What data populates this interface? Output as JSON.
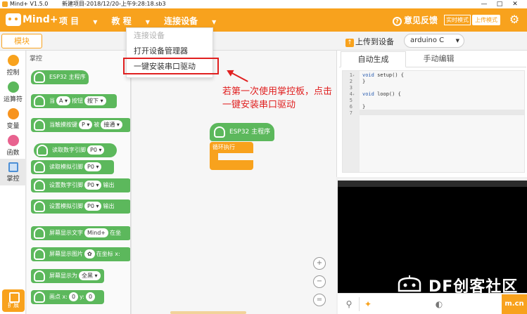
{
  "titlebar": {
    "app": "Mind+ V1.5.0",
    "file": "新建项目-2018/12/20-上午9:28:18.sb3",
    "min": "—",
    "max": "□",
    "close": "✕"
  },
  "header": {
    "brand": "Mind+",
    "menu": [
      {
        "label": "项 目"
      },
      {
        "label": "教 程"
      },
      {
        "label": "连接设备"
      }
    ],
    "caret": "▼",
    "feedback": "意见反馈",
    "feedback_icon": "?",
    "mode_realtime": "实时模式",
    "mode_upload": "上传模式",
    "gear": "⚙"
  },
  "toolbar": {
    "blocks_tab": "模块",
    "upload": "上传到设备",
    "upload_icon": "↑",
    "board": "arduino C",
    "board_caret": "▼"
  },
  "dropdown": {
    "items": [
      {
        "label": "连接设备",
        "disabled": true
      },
      {
        "label": "打开设备管理器"
      },
      {
        "label": "一键安装串口驱动"
      }
    ]
  },
  "categories": [
    {
      "label": "控制",
      "color": "#f8a21d"
    },
    {
      "label": "运算符",
      "color": "#5cb85c"
    },
    {
      "label": "变量",
      "color": "#f7931e"
    },
    {
      "label": "函数",
      "color": "#e8628f"
    },
    {
      "label": "掌控",
      "color": "#4c8fd6"
    }
  ],
  "extension": "扩展",
  "palette": {
    "title": "掌控",
    "blocks": [
      {
        "text": "ESP32 主程序"
      },
      {
        "text": "当",
        "s1": "A ▾",
        "t2": "按钮",
        "s2": "按下 ▾"
      },
      {
        "text": "当触摸按键",
        "s1": "P ▾",
        "t2": "被",
        "s2": "接通 ▾"
      },
      {
        "text": "读取数字引脚",
        "s1": "P0 ▾"
      },
      {
        "text": "读取模拟引脚",
        "s1": "P0 ▾"
      },
      {
        "text": "设置数字引脚",
        "s1": "P0 ▾",
        "t2": "输出"
      },
      {
        "text": "设置模拟引脚",
        "s1": "P0 ▾",
        "t2": "输出"
      },
      {
        "text": "屏幕显示文字",
        "s1": "Mind+",
        "t2": "在坐"
      },
      {
        "text": "屏幕显示图片",
        "s1": "✿",
        "t2": "在坐标 x:"
      },
      {
        "text": "屏幕显示为",
        "s1": "全黑 ▾"
      },
      {
        "text": "画点 x:",
        "s1": "0",
        "t2": "y:",
        "s2": "0"
      }
    ]
  },
  "workspace": {
    "hat_label": "ESP32 主程序",
    "loop_label": "循环执行",
    "zoom_in": "+",
    "zoom_out": "−",
    "reset": "="
  },
  "annotation": "若第一次使用掌控板，点击一键安装串口驱动",
  "right_panel": {
    "tabs": [
      {
        "label": "自动生成"
      },
      {
        "label": "手动编辑"
      }
    ],
    "code_lines": [
      {
        "n": "1",
        "fold": "▾",
        "kw": "void",
        "rest": " setup() {"
      },
      {
        "n": "2",
        "fold": "",
        "kw": "",
        "rest": "}"
      },
      {
        "n": "3",
        "fold": "",
        "kw": "",
        "rest": ""
      },
      {
        "n": "4",
        "fold": "▾",
        "kw": "void",
        "rest": " loop() {"
      },
      {
        "n": "5",
        "fold": "",
        "kw": "",
        "rest": ""
      },
      {
        "n": "6",
        "fold": "",
        "kw": "",
        "rest": "}"
      },
      {
        "n": "7",
        "fold": "",
        "kw": "",
        "rest": ""
      }
    ]
  },
  "bottom": {
    "usb_icon": "⚲",
    "tool_icon": "✦",
    "clear_icon": "◐",
    "corner": "m.cn"
  },
  "watermark": "DF创客社区"
}
